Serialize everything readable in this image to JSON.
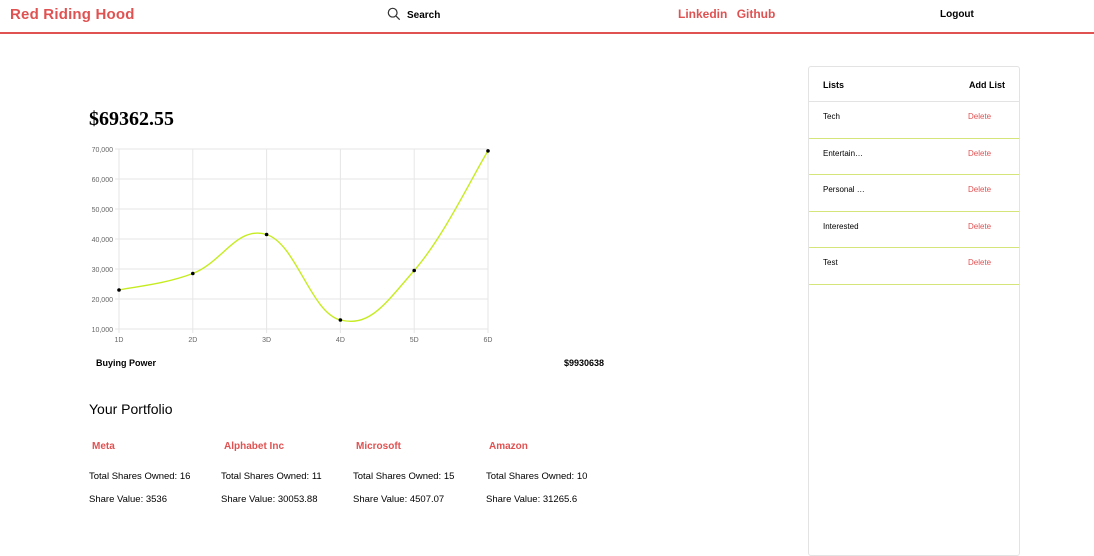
{
  "nav": {
    "brand": "Red Riding Hood",
    "search_label": "Search",
    "linkedin": "Linkedin",
    "github": "Github",
    "logout": "Logout"
  },
  "account": {
    "balance": "$69362.55",
    "buying_power_label": "Buying Power",
    "buying_power_value": "$9930638"
  },
  "chart_data": {
    "type": "line",
    "categories": [
      "1D",
      "2D",
      "3D",
      "4D",
      "5D",
      "6D"
    ],
    "values": [
      23000,
      28500,
      41500,
      13000,
      29500,
      69362.55
    ],
    "ylim": [
      10000,
      70000
    ],
    "yticks": [
      "10,000",
      "20,000",
      "30,000",
      "40,000",
      "50,000",
      "60,000",
      "70,000"
    ],
    "line_color": "#c6ec21",
    "grid": true
  },
  "portfolio": {
    "title": "Your Portfolio",
    "holdings": [
      {
        "name": "Meta",
        "shares": "Total Shares Owned: 16",
        "value": "Share Value: 3536"
      },
      {
        "name": "Alphabet Inc",
        "shares": "Total Shares Owned: 11",
        "value": "Share Value: 30053.88"
      },
      {
        "name": "Microsoft",
        "shares": "Total Shares Owned: 15",
        "value": "Share Value: 4507.07"
      },
      {
        "name": "Amazon",
        "shares": "Total Shares Owned: 10",
        "value": "Share Value: 31265.6"
      }
    ]
  },
  "lists": {
    "title": "Lists",
    "add_label": "Add List",
    "items": [
      {
        "name": "Tech",
        "delete": "Delete"
      },
      {
        "name": "Entertain…",
        "delete": "Delete"
      },
      {
        "name": "Personal …",
        "delete": "Delete"
      },
      {
        "name": "Interested",
        "delete": "Delete"
      },
      {
        "name": "Test",
        "delete": "Delete"
      }
    ]
  },
  "colors": {
    "accent": "#e05252",
    "divider": "#d5e57a"
  }
}
